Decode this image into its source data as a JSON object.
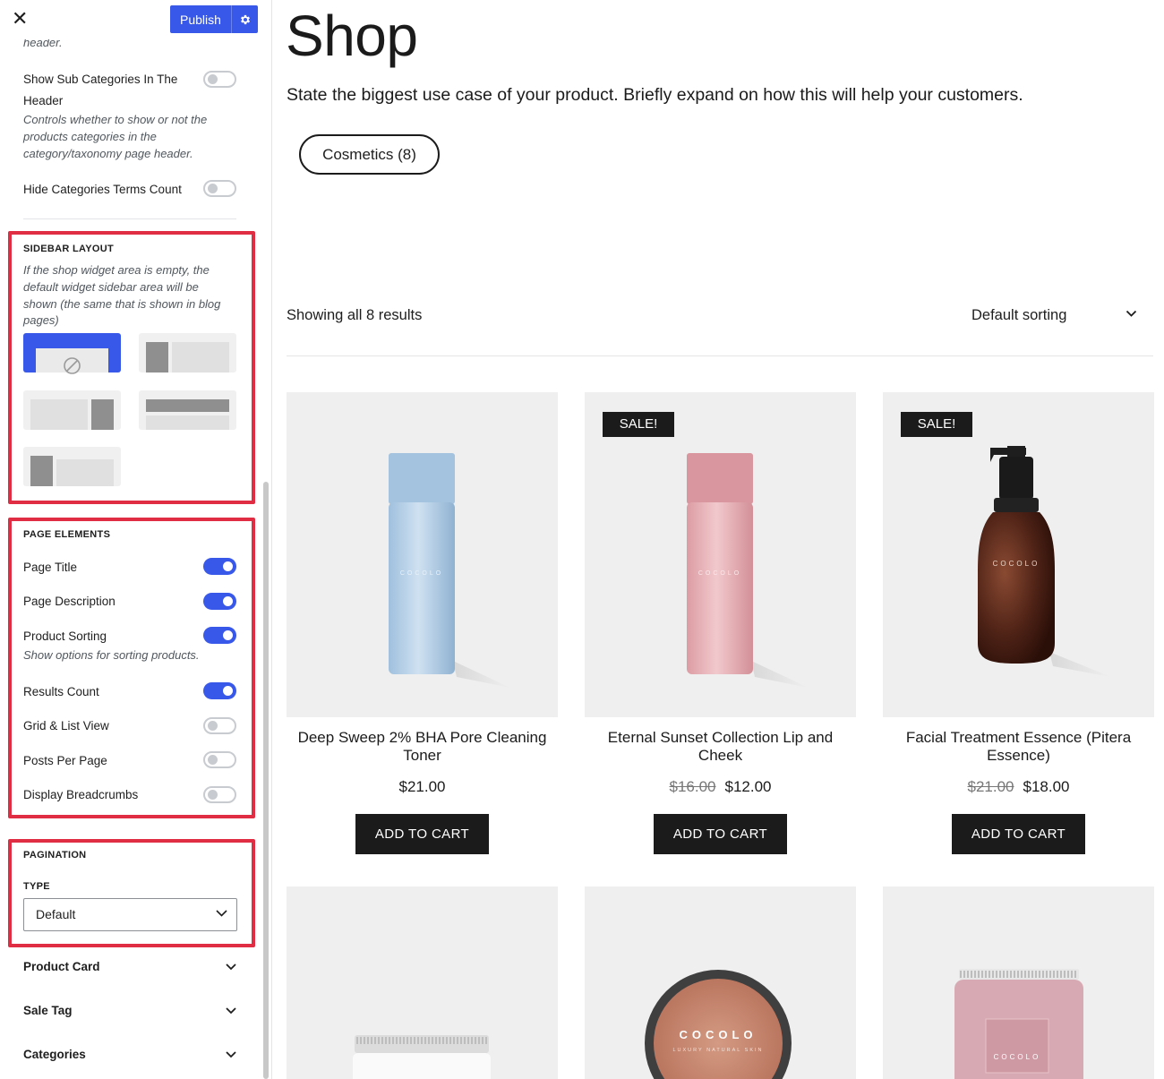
{
  "panel": {
    "close_icon": "close-icon",
    "publish_label": "Publish",
    "gear_icon": "gear-icon",
    "header_truncated": "header.",
    "sub_categories": {
      "label_line1": "Show Sub Categories In The",
      "label_line2": "Header",
      "desc_line1": "Controls whether to show or not the",
      "desc_line2": "products categories in the",
      "desc_line3": "category/taxonomy page header.",
      "enabled": false
    },
    "hide_terms": {
      "label": "Hide Categories Terms Count",
      "enabled": false
    },
    "sidebar_layout": {
      "heading": "SIDEBAR LAYOUT",
      "desc_line1": "If the shop widget area is empty, the",
      "desc_line2": "default widget sidebar area will be",
      "desc_line3": "shown (the same that is shown in blog",
      "desc_line4": "pages)",
      "selected_option": "no-sidebar"
    },
    "page_elements": {
      "heading": "PAGE ELEMENTS",
      "items": [
        {
          "label": "Page Title",
          "enabled": true
        },
        {
          "label": "Page Description",
          "enabled": true
        },
        {
          "label": "Product Sorting",
          "enabled": true,
          "desc": "Show options for sorting products."
        },
        {
          "label": "Results Count",
          "enabled": true
        },
        {
          "label": "Grid & List View",
          "enabled": false
        },
        {
          "label": "Posts Per Page",
          "enabled": false
        },
        {
          "label": "Display Breadcrumbs",
          "enabled": false
        }
      ]
    },
    "pagination": {
      "heading": "PAGINATION",
      "type_label": "TYPE",
      "type_value": "Default"
    },
    "accordions": [
      "Product Card",
      "Sale Tag",
      "Categories"
    ],
    "colors": {
      "accent": "#3858e9",
      "highlight": "#e12d43"
    }
  },
  "shop": {
    "title": "Shop",
    "description": "State the biggest use case of your product. Briefly expand on how this will help your customers.",
    "category_pill": "Cosmetics (8)",
    "results_count": "Showing all 8 results",
    "sorting": "Default sorting",
    "products": [
      {
        "title_line1": "Deep Sweep 2% BHA Pore Cleaning",
        "title_line2": "Toner",
        "price": "$21.00",
        "old_price": "",
        "sale": "",
        "button": "ADD TO CART"
      },
      {
        "title_line1": "Eternal Sunset Collection Lip and",
        "title_line2": "Cheek",
        "price": "$12.00",
        "old_price": "$16.00",
        "sale": "SALE!",
        "button": "ADD TO CART"
      },
      {
        "title_line1": "Facial Treatment Essence (Pitera",
        "title_line2": "Essence)",
        "price": "$18.00",
        "old_price": "$21.00",
        "sale": "SALE!",
        "button": "ADD TO CART"
      }
    ],
    "brand_text": "COCOLO",
    "brand_sub": "LUXURY NATURAL SKIN"
  }
}
